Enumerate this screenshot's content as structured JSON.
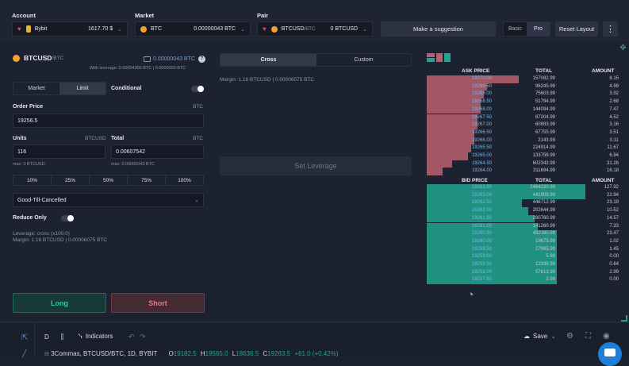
{
  "topbar": {
    "account_label": "Account",
    "account_name": "Bybit",
    "account_value": "1617.70 $",
    "market_label": "Market",
    "market_name": "BTC",
    "market_value": "0.00000043 BTC",
    "pair_label": "Pair",
    "pair_name": "BTCUSD",
    "pair_suffix": "/BTC",
    "pair_value": "0 BTCUSD",
    "suggestion_label": "Make a suggestion",
    "basic_label": "Basic",
    "pro_label": "Pro",
    "reset_label": "Reset Layout"
  },
  "order": {
    "pair": "BTCUSD",
    "pair_suffix": "/BTC",
    "balance": "0.00000043 BTC",
    "with_leverage": "With leverage: 0.00004300 BTC | 0.0000000 BTC",
    "tab_market": "Market",
    "tab_limit": "Limit",
    "tab_conditional": "Conditional",
    "price_label": "Order Price",
    "price_unit": "BTC",
    "price_value": "19256.5",
    "units_label": "Units",
    "units_unit": "BTCUSD",
    "total_label": "Total",
    "total_unit": "BTC",
    "units_value": "116",
    "total_value": "0.00607542",
    "units_max": "max: 0 BTCUSD",
    "total_max": "max: 0.00000043 BTC",
    "percents": [
      "10%",
      "25%",
      "50%",
      "75%",
      "100%"
    ],
    "tif": "Good-Till-Cancelled",
    "reduce_only": "Reduce Only",
    "leverage_line": "Leverage: cross (x100.0)",
    "margin_line": "Margin: 1.16 BTCUSD | 0.00006075 BTC",
    "long_label": "Long",
    "short_label": "Short"
  },
  "leverage": {
    "tab_cross": "Cross",
    "tab_custom": "Custom",
    "margin": "Margin: 1.16 BTCUSD | 0.00006075 BTC",
    "set_label": "Set Leverage"
  },
  "orderbook": {
    "ask_header": "ASK PRICE",
    "bid_header": "BID PRICE",
    "total_header": "TOTAL",
    "amount_header": "AMOUNT",
    "colors": {
      "ask": "#b8606e",
      "bid": "#1fa58f"
    },
    "asks": [
      {
        "price": "19270.00",
        "total": "157082.99",
        "amount": "8.15",
        "depth": 0.58
      },
      {
        "price": "19269.50",
        "total": "96245.99",
        "amount": "4.99",
        "depth": 0.38
      },
      {
        "price": "19269.00",
        "total": "75603.99",
        "amount": "3.92",
        "depth": 0.36
      },
      {
        "price": "19268.50",
        "total": "51794.99",
        "amount": "2.68",
        "depth": 0.34
      },
      {
        "price": "19268.00",
        "total": "144094.99",
        "amount": "7.47",
        "depth": 0.34
      },
      {
        "price": "19267.50",
        "total": "87204.99",
        "amount": "4.52",
        "depth": 0.32
      },
      {
        "price": "19267.00",
        "total": "60893.99",
        "amount": "3.16",
        "depth": 0.32
      },
      {
        "price": "19266.50",
        "total": "67755.99",
        "amount": "3.51",
        "depth": 0.3
      },
      {
        "price": "19266.00",
        "total": "2143.99",
        "amount": "0.11",
        "depth": 0.3
      },
      {
        "price": "19265.50",
        "total": "224914.99",
        "amount": "11.67",
        "depth": 0.28
      },
      {
        "price": "19265.00",
        "total": "133759.99",
        "amount": "6.94",
        "depth": 0.26
      },
      {
        "price": "19264.50",
        "total": "602343.99",
        "amount": "31.26",
        "depth": 0.16
      },
      {
        "price": "19264.00",
        "total": "311694.99",
        "amount": "16.18",
        "depth": 0.1
      }
    ],
    "bids": [
      {
        "price": "19263.50",
        "total": "2464230.99",
        "amount": "127.92",
        "depth": 1.0
      },
      {
        "price": "19263.00",
        "total": "441909.99",
        "amount": "22.94",
        "depth": 1.0
      },
      {
        "price": "19262.50",
        "total": "446712.99",
        "amount": "23.19",
        "depth": 0.6
      },
      {
        "price": "19262.00",
        "total": "202644.99",
        "amount": "10.52",
        "depth": 0.64
      },
      {
        "price": "19261.50",
        "total": "280760.99",
        "amount": "14.57",
        "depth": 0.68
      },
      {
        "price": "19261.00",
        "total": "141260.99",
        "amount": "7.33",
        "depth": 0.7
      },
      {
        "price": "19260.50",
        "total": "452180.99",
        "amount": "23.47",
        "depth": 0.82
      },
      {
        "price": "19260.00",
        "total": "19675.99",
        "amount": "1.02",
        "depth": 0.82
      },
      {
        "price": "19259.50",
        "total": "27985.99",
        "amount": "1.45",
        "depth": 0.82
      },
      {
        "price": "19259.00",
        "total": "5.99",
        "amount": "0.00",
        "depth": 0.82
      },
      {
        "price": "19258.50",
        "total": "12336.99",
        "amount": "0.64",
        "depth": 0.82
      },
      {
        "price": "19258.00",
        "total": "57613.99",
        "amount": "2.99",
        "depth": 0.82
      },
      {
        "price": "19257.50",
        "total": "2.99",
        "amount": "0.00",
        "depth": 0.82
      }
    ]
  },
  "chart_toolbar": {
    "interval": "D",
    "indicators": "Indicators",
    "save": "Save",
    "symbol_line": "3Commas, BTCUSD/BTC, 1D, BYBIT",
    "o_label": "O",
    "o_value": "19182.5",
    "h_label": "H",
    "h_value": "19565.0",
    "l_label": "L",
    "l_value": "18636.5",
    "c_label": "C",
    "c_value": "19263.5",
    "change": "+81.0 (+0.42%)"
  }
}
